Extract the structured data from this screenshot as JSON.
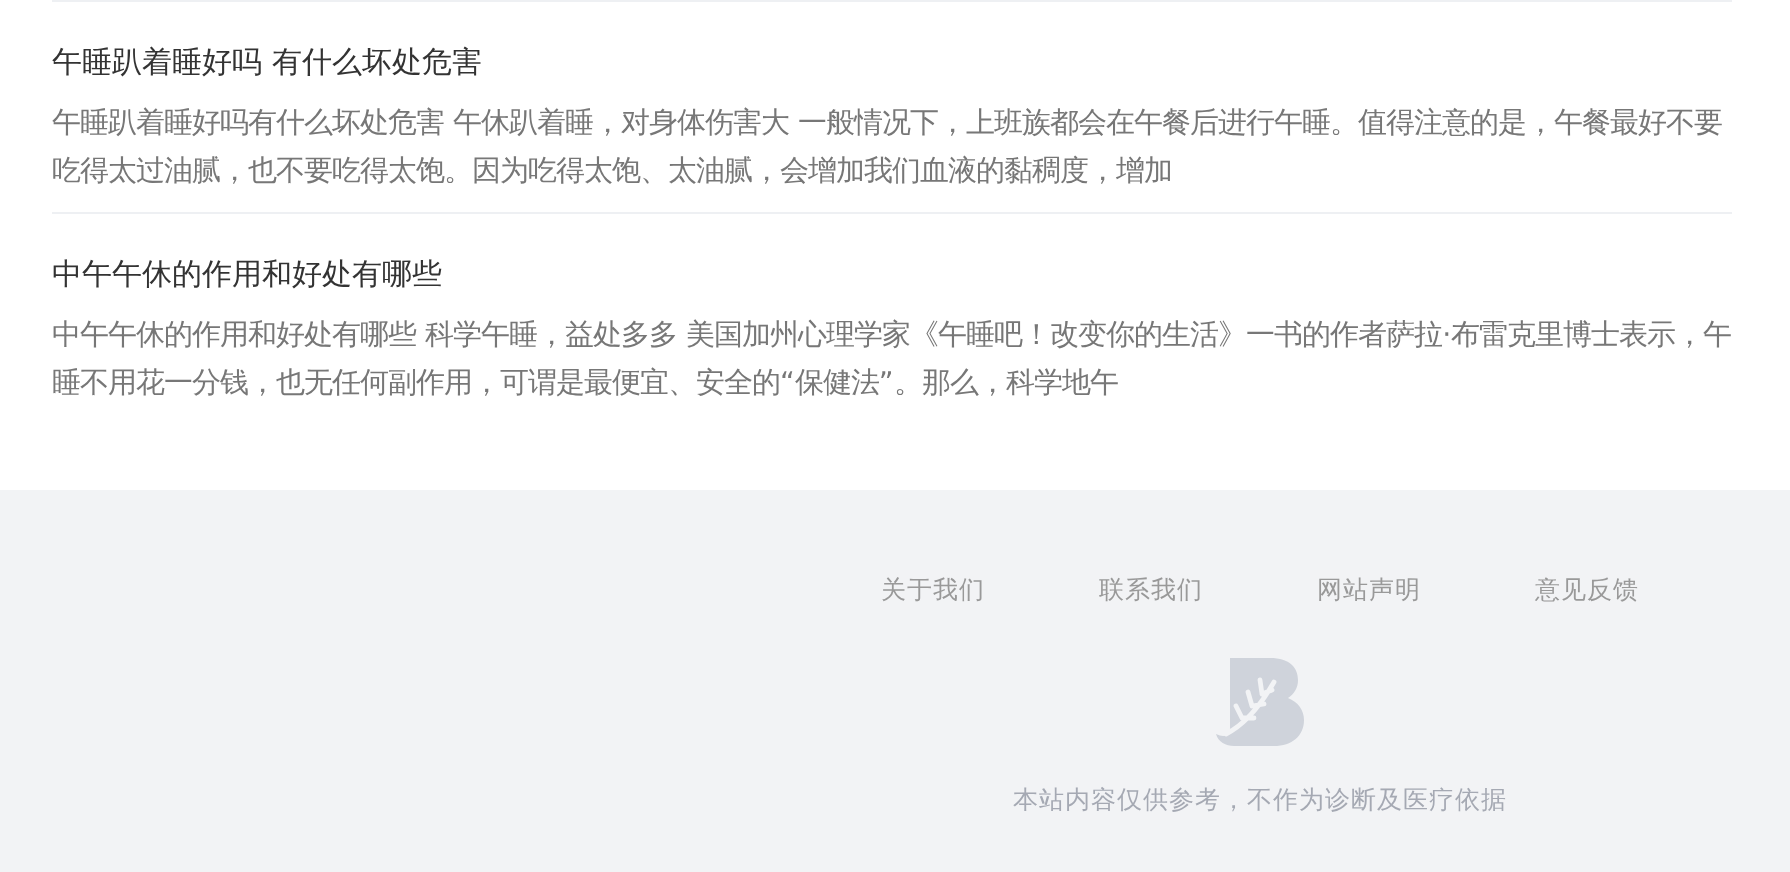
{
  "articles": [
    {
      "title": "午睡趴着睡好吗 有什么坏处危害",
      "summary": "午睡趴着睡好吗有什么坏处危害 午休趴着睡，对身体伤害大 一般情况下，上班族都会在午餐后进行午睡。值得注意的是，午餐最好不要吃得太过油腻，也不要吃得太饱。因为吃得太饱、太油腻，会增加我们血液的黏稠度，增加"
    },
    {
      "title": "中午午休的作用和好处有哪些",
      "summary": "中午午休的作用和好处有哪些 科学午睡，益处多多 美国加州心理学家《午睡吧！改变你的生活》一书的作者萨拉·布雷克里博士表示，午睡不用花一分钱，也无任何副作用，可谓是最便宜、安全的“保健法”。那么，科学地午"
    }
  ],
  "footer": {
    "links": [
      "关于我们",
      "联系我们",
      "网站声明",
      "意见反馈"
    ],
    "disclaimer": "本站内容仅供参考，不作为诊断及医疗依据"
  }
}
